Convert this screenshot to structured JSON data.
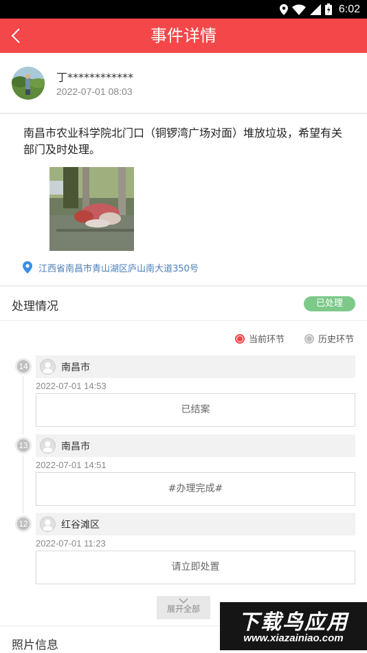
{
  "statusbar": {
    "time": "6:02"
  },
  "header": {
    "title": "事件详情"
  },
  "reporter": {
    "name": "丁************",
    "time": "2022-07-01 08:03"
  },
  "event": {
    "description": "南昌市农业科学院北门口（铜锣湾广场对面）堆放垃圾，希望有关部门及时处理。",
    "location": "江西省南昌市青山湖区庐山南大道350号"
  },
  "process": {
    "title": "处理情况",
    "status": "已处理",
    "legend": {
      "current": "当前环节",
      "history": "历史环节"
    },
    "steps": [
      {
        "num": "14",
        "org": "南昌市",
        "time": "2022-07-01 14:53",
        "note": "已结案"
      },
      {
        "num": "13",
        "org": "南昌市",
        "time": "2022-07-01 14:51",
        "note": "#办理完成#"
      },
      {
        "num": "12",
        "org": "红谷滩区",
        "time": "2022-07-01 11:23",
        "note": "请立即处置"
      }
    ],
    "expand_label": "展开全部"
  },
  "photo_section": {
    "title": "照片信息"
  },
  "watermark": {
    "main": "下载鸟应用",
    "sub": "www.xiazainiao.com"
  },
  "colors": {
    "brand": "#f3474a",
    "status_done": "#7cc98a",
    "location": "#4b7fb8"
  }
}
